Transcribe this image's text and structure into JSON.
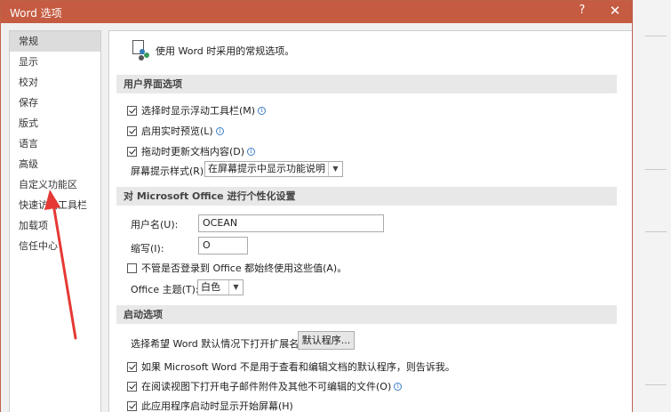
{
  "window": {
    "title": "Word 选项",
    "help": "?",
    "close": "✕"
  },
  "nav": {
    "items": [
      "常规",
      "显示",
      "校对",
      "保存",
      "版式",
      "语言",
      "高级",
      "自定义功能区",
      "快速访问工具栏",
      "加载项",
      "信任中心"
    ],
    "active_index": 0
  },
  "header": {
    "text": "使用 Word 时采用的常规选项。"
  },
  "ui_options": {
    "section": "用户界面选项",
    "mini_toolbar": "选择时显示浮动工具栏(M)",
    "live_preview": "启用实时预览(L)",
    "update_on_drag": "拖动时更新文档内容(D)",
    "screentip_label": "屏幕提示样式(R):",
    "screentip_value": "在屏幕提示中显示功能说明"
  },
  "personalize": {
    "section": "对 Microsoft Office 进行个性化设置",
    "username_label": "用户名(U):",
    "username_value": "OCEAN",
    "initials_label": "缩写(I):",
    "initials_value": "O",
    "always_use": "不管是否登录到 Office 都始终使用这些值(A)。",
    "theme_label": "Office 主题(T):",
    "theme_value": "白色"
  },
  "startup": {
    "section": "启动选项",
    "extensions_label": "选择希望 Word 默认情况下打开扩展名:",
    "default_programs_button": "默认程序...",
    "tell_me": "如果 Microsoft Word 不是用于查看和编辑文档的默认程序，则告诉我。",
    "reading_view": "在阅读视图下打开电子邮件附件及其他不可编辑的文件(O)",
    "start_screen": "此应用程序启动时显示开始屏幕(H)"
  },
  "colors": {
    "titlebar": "#c55b41",
    "annotation": "#e53935"
  }
}
